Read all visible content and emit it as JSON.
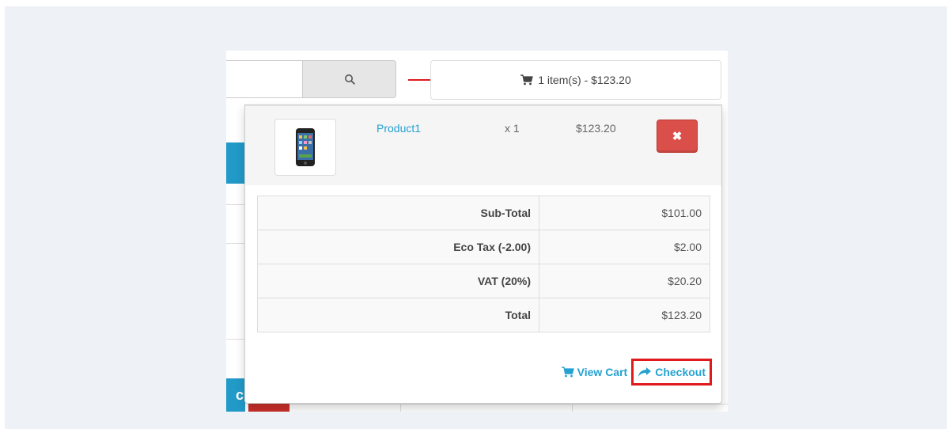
{
  "header": {
    "search_icon": "search-icon",
    "cart_icon": "shopping-cart-icon",
    "cart_summary": "1 item(s) - $123.20"
  },
  "cart_dropdown": {
    "item": {
      "name": "Product1",
      "quantity": "x 1",
      "price": "$123.20",
      "remove_icon": "close-icon"
    },
    "totals": [
      {
        "label": "Sub-Total",
        "value": "$101.00"
      },
      {
        "label": "Eco Tax (-2.00)",
        "value": "$2.00"
      },
      {
        "label": "VAT (20%)",
        "value": "$20.20"
      },
      {
        "label": "Total",
        "value": "$123.20"
      }
    ],
    "view_cart_label": "View Cart",
    "checkout_label": "Checkout"
  },
  "annotation_colors": {
    "highlight": "#e0191d",
    "link": "#23a1d1",
    "remove_button": "#da4f49"
  }
}
